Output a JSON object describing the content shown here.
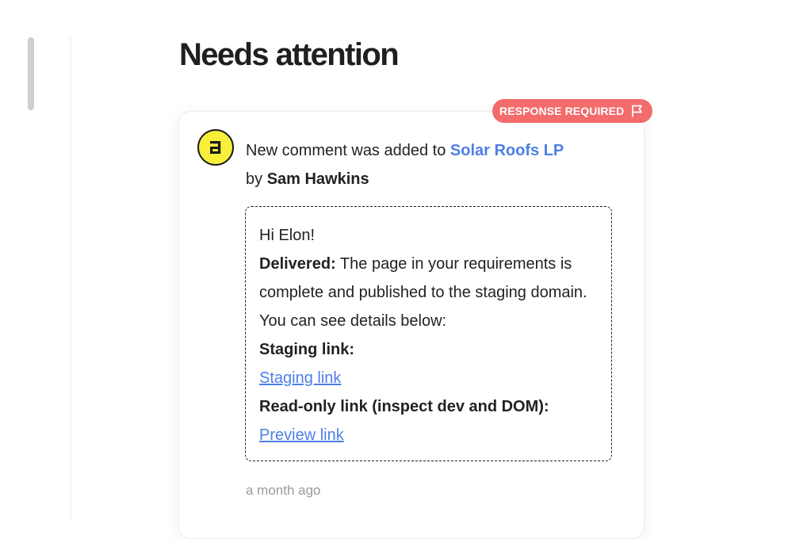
{
  "page": {
    "title": "Needs attention"
  },
  "notification": {
    "badge_label": "RESPONSE REQUIRED",
    "badge_icon": "flag-icon",
    "avatar_icon": "a-logo-icon",
    "headline_prefix": "New comment was added to",
    "project_name": "Solar Roofs LP",
    "by_label": "by",
    "author": "Sam Hawkins",
    "timestamp": "a month ago",
    "message": {
      "greeting": "Hi Elon!",
      "delivered_label": "Delivered:",
      "delivered_text": "The page in your requirements is complete and published to the staging domain. You can see details below:",
      "staging_label": "Staging link:",
      "staging_link_text": "Staging link",
      "readonly_label": "Read-only link (inspect dev and DOM):",
      "preview_link_text": "Preview link"
    }
  },
  "colors": {
    "accent": "#4d7fe6",
    "badge": "#f36b6b",
    "avatar": "#f7ef3a"
  }
}
